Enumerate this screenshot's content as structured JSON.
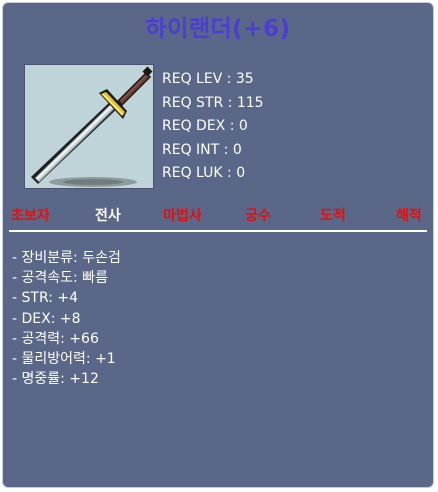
{
  "item": {
    "name": "하이랜더(+6)"
  },
  "requirements": [
    "REQ LEV : 35",
    "REQ STR : 115",
    "REQ DEX : 0",
    "REQ INT : 0",
    "REQ LUK : 0"
  ],
  "jobs": [
    {
      "label": "초보자",
      "allowed": false
    },
    {
      "label": "전사",
      "allowed": true
    },
    {
      "label": "마법사",
      "allowed": false
    },
    {
      "label": "궁수",
      "allowed": false
    },
    {
      "label": "도적",
      "allowed": false
    },
    {
      "label": "해적",
      "allowed": false
    }
  ],
  "stats": [
    "- 장비분류: 두손검",
    "- 공격속도: 빠름",
    "- STR: +4",
    "- DEX: +8",
    "- 공격력: +66",
    "- 물리방어력: +1",
    "- 명중률: +12"
  ],
  "colors": {
    "panel_bg": "#5b6788",
    "title": "#4c3cd8",
    "job_allowed": "#ffffff",
    "job_disallowed": "#e01010",
    "icon_bg": "#bfd4d8"
  },
  "icon": "two-handed-sword-icon"
}
